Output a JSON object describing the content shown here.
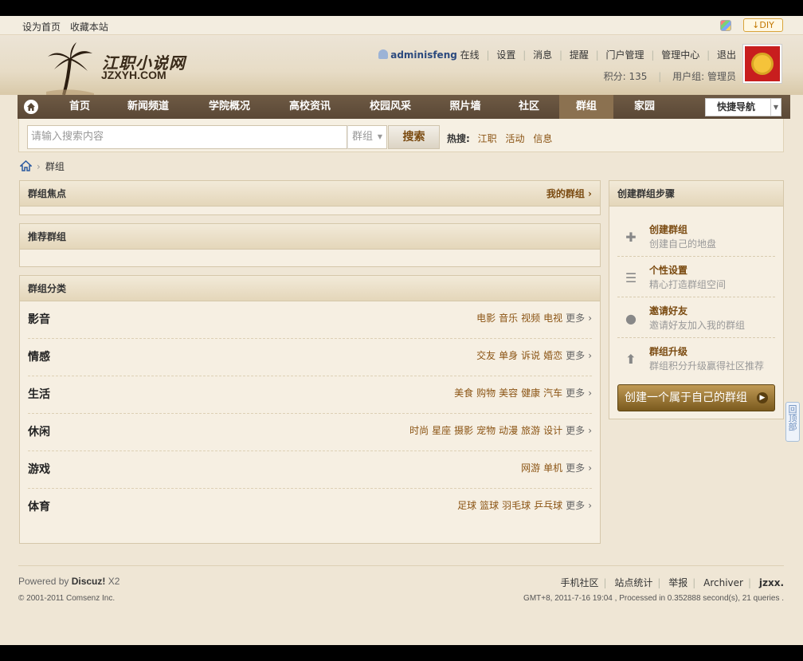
{
  "topbar": {
    "set_home": "设为首页",
    "bookmark": "收藏本站",
    "diy": "DIY"
  },
  "logo": {
    "cn": "江职小说网",
    "en": "JZXYH.COM"
  },
  "user": {
    "name": "adminisfeng",
    "status": "在线",
    "links": [
      "设置",
      "消息",
      "提醒",
      "门户管理",
      "管理中心",
      "退出"
    ],
    "credits": "积分: 135",
    "group": "用户组: 管理员"
  },
  "nav": {
    "items": [
      "首页",
      "新闻频道",
      "学院概况",
      "高校资讯",
      "校园风采",
      "照片墙",
      "社区",
      "群组",
      "家园"
    ],
    "active_index": 7,
    "quick": "快捷导航"
  },
  "search": {
    "placeholder": "请输入搜索内容",
    "scope": "群组",
    "button": "搜索",
    "hot_label": "热搜:",
    "hot": [
      "江职",
      "活动",
      "信息"
    ]
  },
  "breadcrumb": {
    "current": "群组"
  },
  "focus": {
    "title": "群组焦点",
    "my": "我的群组"
  },
  "recommend": {
    "title": "推荐群组"
  },
  "categories": {
    "title": "群组分类",
    "more": "更多",
    "rows": [
      {
        "name": "影音",
        "links": [
          "电影",
          "音乐",
          "视频",
          "电视"
        ]
      },
      {
        "name": "情感",
        "links": [
          "交友",
          "单身",
          "诉说",
          "婚恋"
        ]
      },
      {
        "name": "生活",
        "links": [
          "美食",
          "购物",
          "美容",
          "健康",
          "汽车"
        ]
      },
      {
        "name": "休闲",
        "links": [
          "时尚",
          "星座",
          "摄影",
          "宠物",
          "动漫",
          "旅游",
          "设计"
        ]
      },
      {
        "name": "游戏",
        "links": [
          "网游",
          "单机"
        ]
      },
      {
        "name": "体育",
        "links": [
          "足球",
          "篮球",
          "羽毛球",
          "乒乓球"
        ]
      }
    ]
  },
  "steps": {
    "title": "创建群组步骤",
    "items": [
      {
        "icon": "plus-icon",
        "title": "创建群组",
        "desc": "创建自己的地盘"
      },
      {
        "icon": "list-icon",
        "title": "个性设置",
        "desc": "精心打造群组空间"
      },
      {
        "icon": "person-icon",
        "title": "邀请好友",
        "desc": "邀请好友加入我的群组"
      },
      {
        "icon": "up-arrow-icon",
        "title": "群组升级",
        "desc": "群组积分升级赢得社区推荐"
      }
    ],
    "create_button": "创建一个属于自己的群组"
  },
  "backtop": "回顶部",
  "footer": {
    "powered_prefix": "Powered by ",
    "powered_brand": "Discuz!",
    "powered_ver": " X2",
    "copyright": "© 2001-2011 Comsenz Inc.",
    "links": [
      "手机社区",
      "站点统计",
      "举报",
      "Archiver",
      "jzxx."
    ],
    "info": "GMT+8, 2011-7-16 19:04 , Processed in 0.352888 second(s), 21 queries ."
  }
}
